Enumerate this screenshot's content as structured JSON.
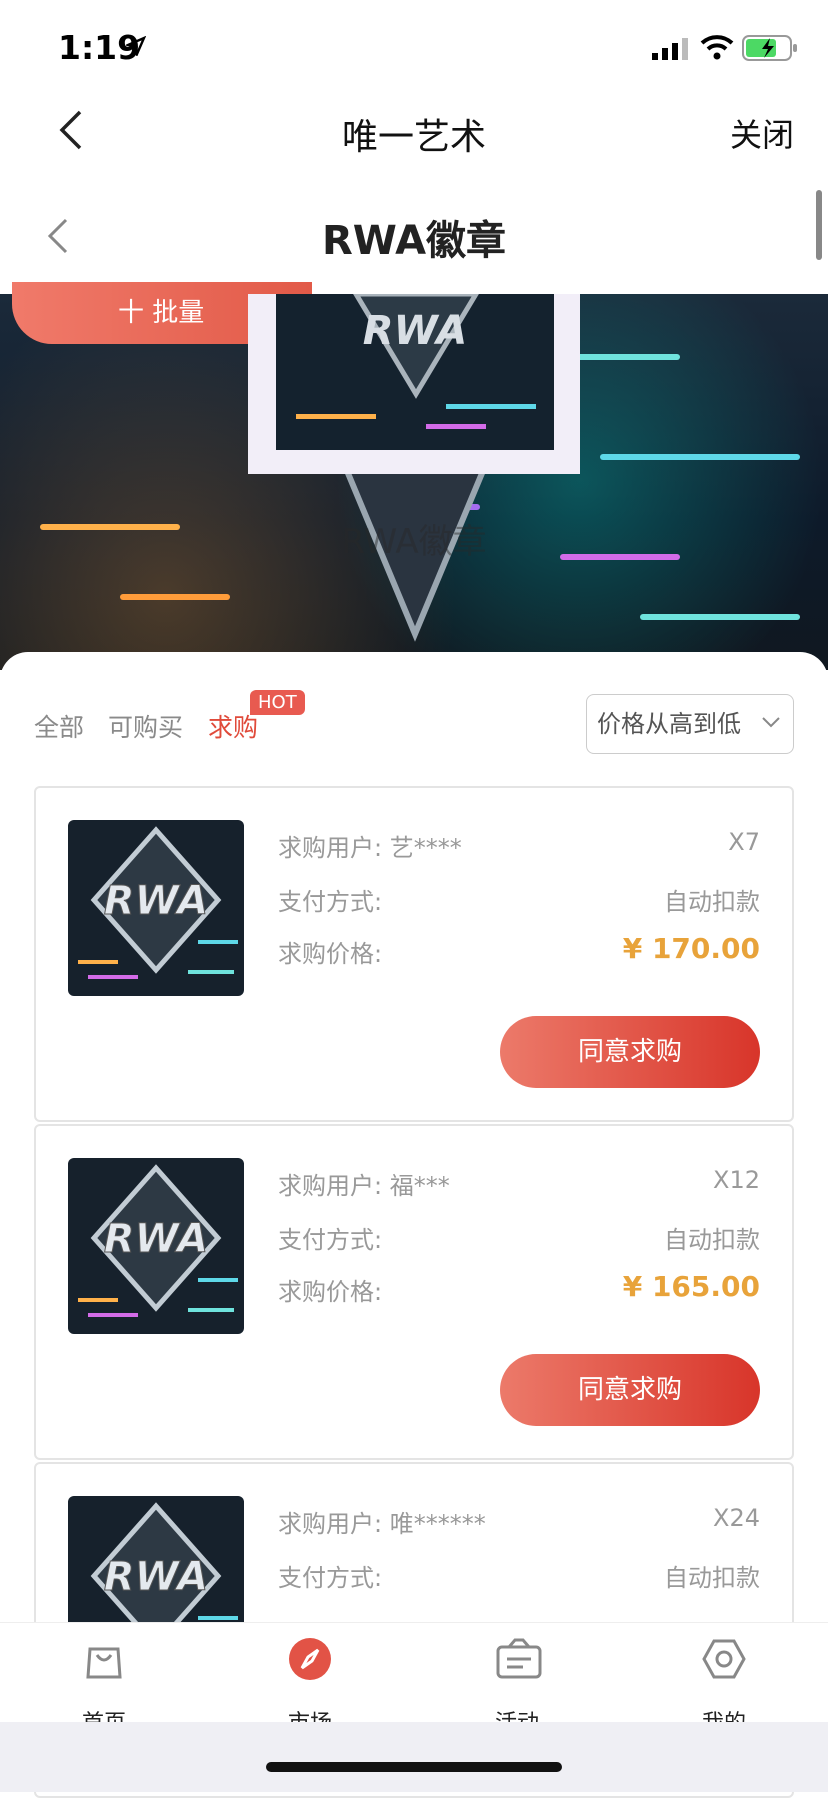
{
  "status_bar": {
    "time": "1:19"
  },
  "nav": {
    "title": "唯一艺术",
    "close_label": "关闭"
  },
  "sub_header": {
    "title": "RWA徽章"
  },
  "banner": {
    "batch_label": "十  批量",
    "caption": "RWA徽章"
  },
  "tabs": [
    {
      "label": "全部",
      "active": false
    },
    {
      "label": "可购买",
      "active": false
    },
    {
      "label": "求购",
      "active": true
    }
  ],
  "hot_badge": "HOT",
  "sort": {
    "selected": "价格从高到低"
  },
  "cards": [
    {
      "user_label": "求购用户:",
      "user": "艺****",
      "qty": "X7",
      "pay_label": "支付方式:",
      "pay": "自动扣款",
      "price_label": "求购价格:",
      "price": "¥ 170.00",
      "button": "同意求购"
    },
    {
      "user_label": "求购用户:",
      "user": "福***",
      "qty": "X12",
      "pay_label": "支付方式:",
      "pay": "自动扣款",
      "price_label": "求购价格:",
      "price": "¥ 165.00",
      "button": "同意求购"
    },
    {
      "user_label": "求购用户:",
      "user": "唯******",
      "qty": "X24",
      "pay_label": "支付方式:",
      "pay": "自动扣款"
    }
  ],
  "tab_bar": [
    {
      "label": "首页",
      "icon": "bag-icon"
    },
    {
      "label": "市场",
      "icon": "compass-icon"
    },
    {
      "label": "活动",
      "icon": "ticket-icon"
    },
    {
      "label": "我的",
      "icon": "hexagon-icon"
    }
  ],
  "colors": {
    "accent": "#e04a3a",
    "price": "#e8a33a",
    "button_start": "#ec7a6a",
    "button_end": "#d8352a"
  }
}
